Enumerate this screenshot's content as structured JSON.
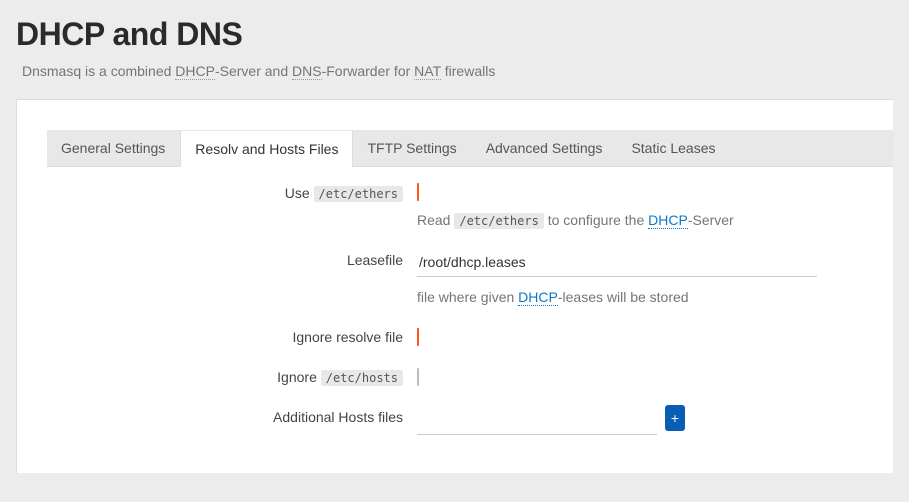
{
  "page": {
    "title": "DHCP and DNS",
    "desc_parts": {
      "p1": "Dnsmasq is a combined ",
      "link_dhcp": "DHCP",
      "p2": "-Server and ",
      "link_dns": "DNS",
      "p3": "-Forwarder for ",
      "link_nat": "NAT",
      "p4": " firewalls"
    }
  },
  "tabs": {
    "general": "General Settings",
    "resolv": "Resolv and Hosts Files",
    "tftp": "TFTP Settings",
    "advanced": "Advanced Settings",
    "static": "Static Leases"
  },
  "rows": {
    "use_ethers": {
      "label_pre": "Use ",
      "label_code": "/etc/ethers",
      "checked": true,
      "help_pre": "Read ",
      "help_code": "/etc/ethers",
      "help_mid": " to configure the ",
      "help_link": "DHCP",
      "help_post": "-Server"
    },
    "leasefile": {
      "label": "Leasefile",
      "value": "/root/dhcp.leases",
      "help_pre": "file where given ",
      "help_link": "DHCP",
      "help_post": "-leases will be stored"
    },
    "ignore_resolv": {
      "label": "Ignore resolve file",
      "checked": true
    },
    "ignore_hosts": {
      "label_pre": "Ignore ",
      "label_code": "/etc/hosts",
      "checked": false
    },
    "additional_hosts": {
      "label": "Additional Hosts files",
      "value": "",
      "add_button": "+"
    }
  }
}
